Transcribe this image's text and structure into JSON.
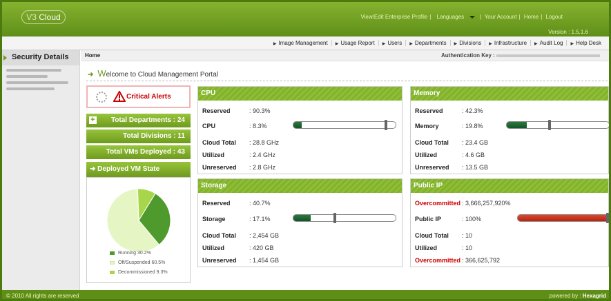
{
  "brand": {
    "logo_prefix": "V3",
    "logo_name": "Cloud"
  },
  "top_links": [
    "View/Edit Enterprise Profile",
    "Languages",
    "Your Account",
    "Home",
    "Logout"
  ],
  "version": "Version : 1.5.1.6",
  "nav": [
    "Image Management",
    "Usage Report",
    "Users",
    "Departments",
    "Divisions",
    "Infrastructure",
    "Audit Log",
    "Help Desk"
  ],
  "sidebar": {
    "title": "Security Details"
  },
  "breadcrumb": "Home",
  "auth_key_label": "Authentication Key :",
  "welcome": {
    "initial": "W",
    "rest": "elcome to Cloud Management Portal"
  },
  "alerts": {
    "label": "Critical Alerts"
  },
  "summary": {
    "departments": "Total Departments : 24",
    "divisions": "Total Divisions : 11",
    "vms": "Total VMs Deployed : 43"
  },
  "vm_state": {
    "title": "Deployed VM State",
    "colors": {
      "running": "#4f9a2c",
      "off": "#e6f5c4",
      "decommissioned": "#a8d64a"
    },
    "chart_data": {
      "type": "pie",
      "categories": [
        "Running",
        "Off/Suspended",
        "Decommissioned"
      ],
      "values": [
        30.2,
        60.5,
        9.3
      ],
      "legend": [
        "Running 30.2%",
        "Off/Suspended 60.5%",
        "Decommissioned 9.3%"
      ]
    }
  },
  "cpu": {
    "title": "CPU",
    "reserved": {
      "label": "Reserved",
      "value": ": 90.3%"
    },
    "usage": {
      "label": "CPU",
      "value": ": 8.3%",
      "fill": 0.083,
      "reserved": 0.903
    },
    "cloud_total": {
      "label": "Cloud Total",
      "value": ": 28.8 GHz"
    },
    "utilized": {
      "label": "Utilized",
      "value": ": 2.4 GHz"
    },
    "unreserved": {
      "label": "Unreserved",
      "value": ": 2.8 GHz"
    }
  },
  "memory": {
    "title": "Memory",
    "reserved": {
      "label": "Reserved",
      "value": ": 42.3%"
    },
    "usage": {
      "label": "Memory",
      "value": ": 19.8%",
      "fill": 0.198,
      "reserved": 0.423
    },
    "cloud_total": {
      "label": "Cloud Total",
      "value": ": 23.4 GB"
    },
    "utilized": {
      "label": "Utilized",
      "value": ": 4.6 GB"
    },
    "unreserved": {
      "label": "Unreserved",
      "value": ": 13.5 GB"
    }
  },
  "storage": {
    "title": "Storage",
    "reserved": {
      "label": "Reserved",
      "value": ": 40.7%"
    },
    "usage": {
      "label": "Storage",
      "value": ": 17.1%",
      "fill": 0.171,
      "reserved": 0.407
    },
    "cloud_total": {
      "label": "Cloud Total",
      "value": ": 2,454 GB"
    },
    "utilized": {
      "label": "Utilized",
      "value": ": 420 GB"
    },
    "unreserved": {
      "label": "Unreserved",
      "value": ": 1,454 GB"
    }
  },
  "public_ip": {
    "title": "Public IP",
    "overcommitted_top": {
      "label": "Overcommitted",
      "value": ": 3,666,257,920%"
    },
    "usage": {
      "label": "Public IP",
      "value": ": 100%",
      "fill": 1.0
    },
    "cloud_total": {
      "label": "Cloud Total",
      "value": ": 10"
    },
    "utilized": {
      "label": "Utilized",
      "value": ": 10"
    },
    "overcommitted_bottom": {
      "label": "Overcommitted",
      "value": ": 366,625,792"
    }
  },
  "footer": {
    "copyright": "© 2010 All rights are reserved",
    "powered_by": "powered by :",
    "vendor": "Hexagrid"
  }
}
